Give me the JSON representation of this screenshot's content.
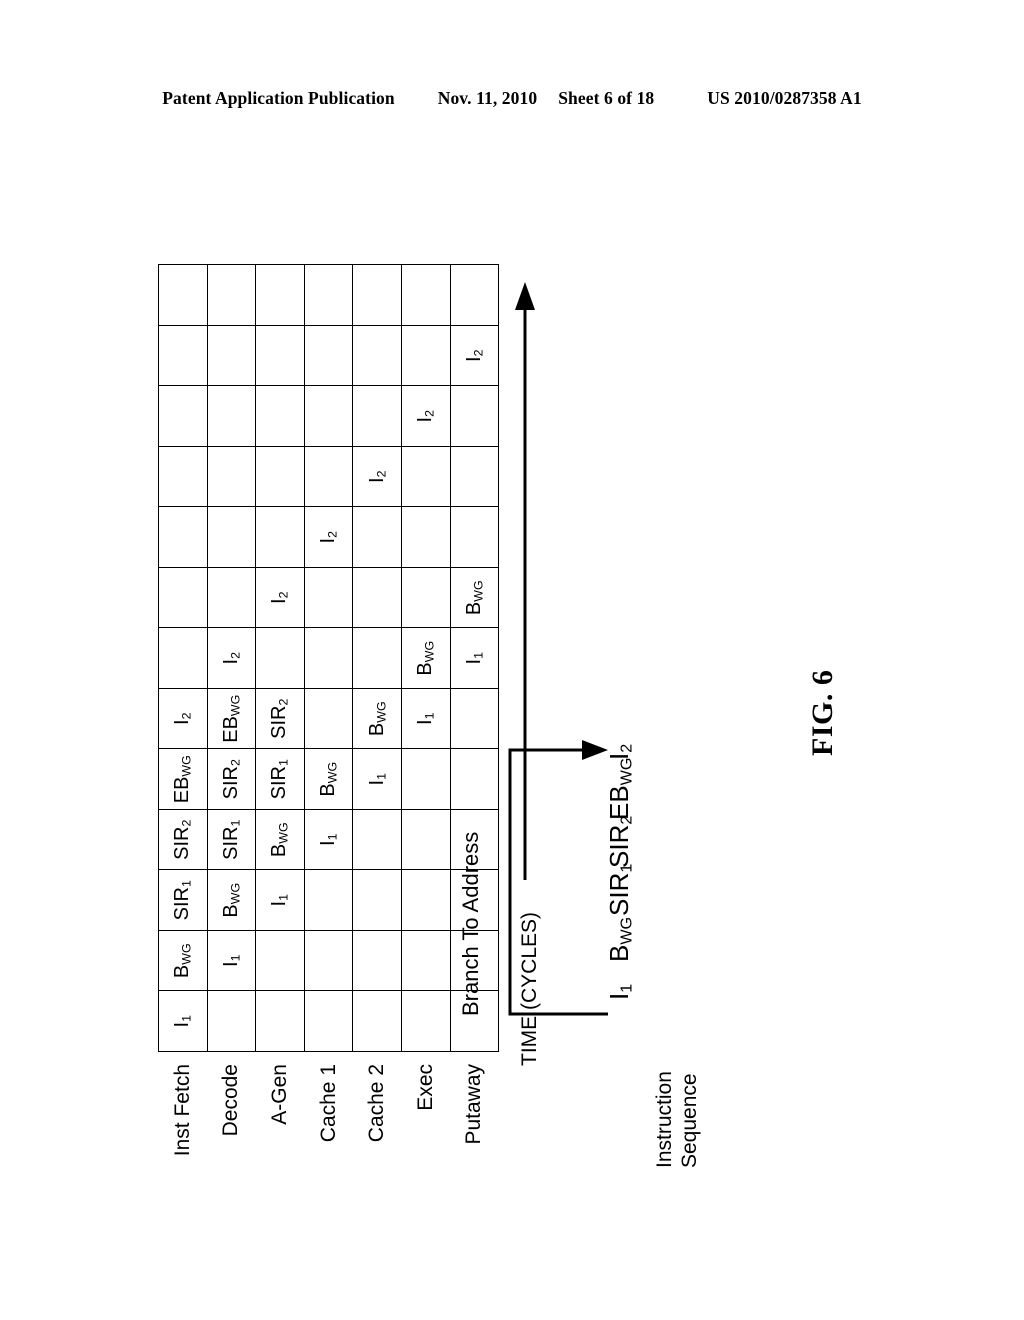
{
  "header": {
    "publication": "Patent Application Publication",
    "date": "Nov. 11, 2010",
    "sheet": "Sheet 6 of 18",
    "patent_number": "US 2010/0287358 A1"
  },
  "figure": {
    "number": "FIG. 6",
    "sequence_caption": "Instruction\nSequence",
    "branch_caption": "Branch To Address",
    "time_axis_label": "TIME (CYCLES)",
    "instruction_sequence": [
      {
        "id": "i1",
        "base": "I",
        "sub": "1"
      },
      {
        "id": "bwg",
        "base": "B",
        "sub": "WG"
      },
      {
        "id": "sir1",
        "base": "SIR",
        "sub": "1"
      },
      {
        "id": "sir2",
        "base": "SIR",
        "sub": "2"
      },
      {
        "id": "ebwg",
        "base": "EB",
        "sub": "WG"
      },
      {
        "id": "i2",
        "base": "I",
        "sub": "2"
      }
    ]
  },
  "chart_data": {
    "type": "table",
    "title": "FIG. 6",
    "xlabel": "TIME (CYCLES)",
    "ylabel": "",
    "cycle_count": 13,
    "stages": [
      "Inst Fetch",
      "Decode",
      "A-Gen",
      "Cache 1",
      "Cache 2",
      "Exec",
      "Putaway"
    ],
    "rows": [
      {
        "stage": "Inst Fetch",
        "cells": [
          {
            "base": "I",
            "sub": "1"
          },
          {
            "base": "B",
            "sub": "WG"
          },
          {
            "base": "SIR",
            "sub": "1"
          },
          {
            "base": "SIR",
            "sub": "2"
          },
          {
            "base": "EB",
            "sub": "WG"
          },
          {
            "base": "I",
            "sub": "2"
          },
          {
            "base": "",
            "sub": ""
          },
          {
            "base": "",
            "sub": ""
          },
          {
            "base": "",
            "sub": ""
          },
          {
            "base": "",
            "sub": ""
          },
          {
            "base": "",
            "sub": ""
          },
          {
            "base": "",
            "sub": ""
          },
          {
            "base": "",
            "sub": ""
          }
        ]
      },
      {
        "stage": "Decode",
        "cells": [
          {
            "base": "",
            "sub": ""
          },
          {
            "base": "I",
            "sub": "1"
          },
          {
            "base": "B",
            "sub": "WG"
          },
          {
            "base": "SIR",
            "sub": "1"
          },
          {
            "base": "SIR",
            "sub": "2"
          },
          {
            "base": "EB",
            "sub": "WG"
          },
          {
            "base": "I",
            "sub": "2"
          },
          {
            "base": "",
            "sub": ""
          },
          {
            "base": "",
            "sub": ""
          },
          {
            "base": "",
            "sub": ""
          },
          {
            "base": "",
            "sub": ""
          },
          {
            "base": "",
            "sub": ""
          },
          {
            "base": "",
            "sub": ""
          }
        ]
      },
      {
        "stage": "A-Gen",
        "cells": [
          {
            "base": "",
            "sub": ""
          },
          {
            "base": "",
            "sub": ""
          },
          {
            "base": "I",
            "sub": "1"
          },
          {
            "base": "B",
            "sub": "WG"
          },
          {
            "base": "SIR",
            "sub": "1"
          },
          {
            "base": "SIR",
            "sub": "2"
          },
          {
            "base": "",
            "sub": ""
          },
          {
            "base": "I",
            "sub": "2"
          },
          {
            "base": "",
            "sub": ""
          },
          {
            "base": "",
            "sub": ""
          },
          {
            "base": "",
            "sub": ""
          },
          {
            "base": "",
            "sub": ""
          },
          {
            "base": "",
            "sub": ""
          }
        ]
      },
      {
        "stage": "Cache 1",
        "cells": [
          {
            "base": "",
            "sub": ""
          },
          {
            "base": "",
            "sub": ""
          },
          {
            "base": "",
            "sub": ""
          },
          {
            "base": "I",
            "sub": "1"
          },
          {
            "base": "B",
            "sub": "WG"
          },
          {
            "base": "",
            "sub": ""
          },
          {
            "base": "",
            "sub": ""
          },
          {
            "base": "",
            "sub": ""
          },
          {
            "base": "I",
            "sub": "2"
          },
          {
            "base": "",
            "sub": ""
          },
          {
            "base": "",
            "sub": ""
          },
          {
            "base": "",
            "sub": ""
          },
          {
            "base": "",
            "sub": ""
          }
        ]
      },
      {
        "stage": "Cache 2",
        "cells": [
          {
            "base": "",
            "sub": ""
          },
          {
            "base": "",
            "sub": ""
          },
          {
            "base": "",
            "sub": ""
          },
          {
            "base": "",
            "sub": ""
          },
          {
            "base": "I",
            "sub": "1"
          },
          {
            "base": "B",
            "sub": "WG"
          },
          {
            "base": "",
            "sub": ""
          },
          {
            "base": "",
            "sub": ""
          },
          {
            "base": "",
            "sub": ""
          },
          {
            "base": "I",
            "sub": "2"
          },
          {
            "base": "",
            "sub": ""
          },
          {
            "base": "",
            "sub": ""
          },
          {
            "base": "",
            "sub": ""
          }
        ]
      },
      {
        "stage": "Exec",
        "cells": [
          {
            "base": "",
            "sub": ""
          },
          {
            "base": "",
            "sub": ""
          },
          {
            "base": "",
            "sub": ""
          },
          {
            "base": "",
            "sub": ""
          },
          {
            "base": "",
            "sub": ""
          },
          {
            "base": "I",
            "sub": "1"
          },
          {
            "base": "B",
            "sub": "WG"
          },
          {
            "base": "",
            "sub": ""
          },
          {
            "base": "",
            "sub": ""
          },
          {
            "base": "",
            "sub": ""
          },
          {
            "base": "I",
            "sub": "2"
          },
          {
            "base": "",
            "sub": ""
          },
          {
            "base": "",
            "sub": ""
          }
        ]
      },
      {
        "stage": "Putaway",
        "cells": [
          {
            "base": "",
            "sub": ""
          },
          {
            "base": "",
            "sub": ""
          },
          {
            "base": "",
            "sub": ""
          },
          {
            "base": "",
            "sub": ""
          },
          {
            "base": "",
            "sub": ""
          },
          {
            "base": "",
            "sub": ""
          },
          {
            "base": "I",
            "sub": "1"
          },
          {
            "base": "B",
            "sub": "WG"
          },
          {
            "base": "",
            "sub": ""
          },
          {
            "base": "",
            "sub": ""
          },
          {
            "base": "",
            "sub": ""
          },
          {
            "base": "I",
            "sub": "2"
          },
          {
            "base": "",
            "sub": ""
          }
        ]
      }
    ]
  }
}
